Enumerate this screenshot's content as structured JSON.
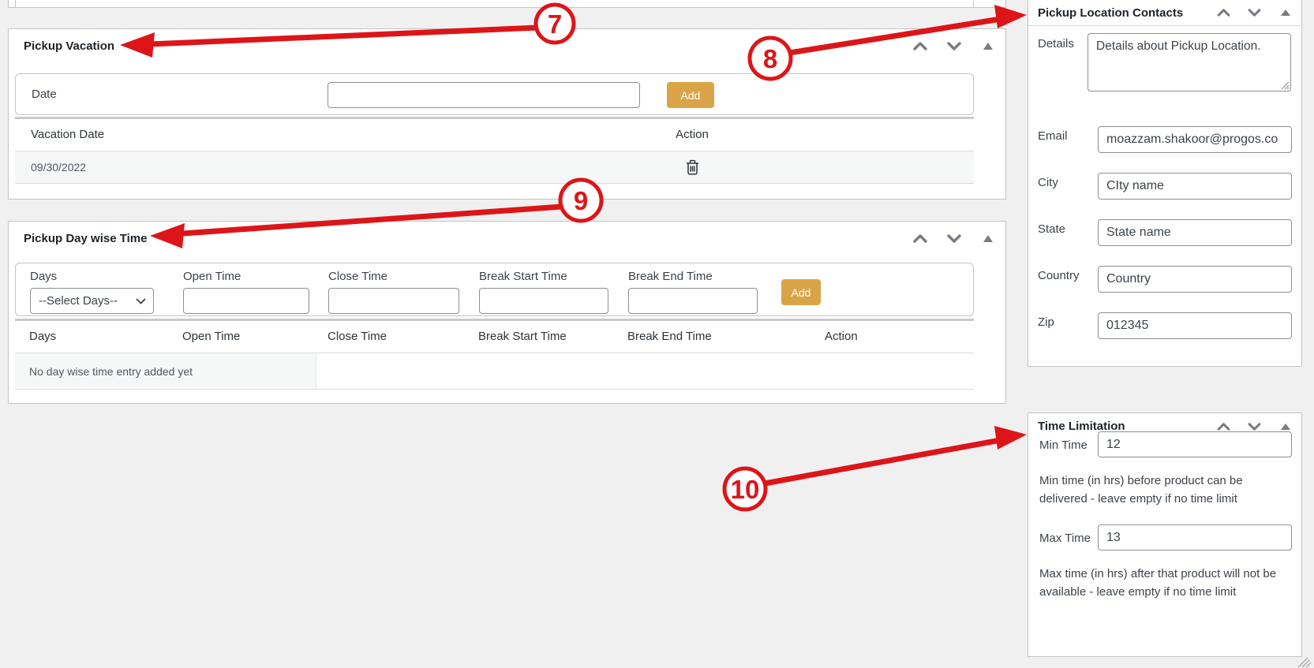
{
  "colors": {
    "page_bg": "#f0f0f1",
    "panel_border": "#c3c4c7",
    "input_border": "#8c8f94",
    "separator": "#dcdcde",
    "stripe_bg": "#f6f7f7",
    "title_text": "#1d2327",
    "body_text": "#3c434a",
    "muted_text": "#50575e",
    "icon_gray": "#787c82",
    "button_gold": "#d9a448",
    "accent_red": "#dd1518"
  },
  "icons": {
    "collapse_up": "chevron-up",
    "collapse_down": "chevron-down",
    "panel_toggle": "triangle-up",
    "delete": "trash",
    "select_arrow": "chevron-down"
  },
  "main": {
    "pickup_vacation": {
      "title": "Pickup Vacation",
      "form": {
        "date_label": "Date",
        "date_value": "",
        "add_label": "Add"
      },
      "table": {
        "col_date": "Vacation Date",
        "col_action": "Action",
        "row_date": "09/30/2022"
      }
    },
    "pickup_day_wise_time": {
      "title": "Pickup Day wise Time",
      "form": {
        "days_label": "Days",
        "days_value": "--Select Days--",
        "open_label": "Open Time",
        "close_label": "Close Time",
        "break_start_label": "Break Start Time",
        "break_end_label": "Break End Time",
        "add_label": "Add"
      },
      "table": {
        "col_days": "Days",
        "col_open": "Open Time",
        "col_close": "Close Time",
        "col_break_start": "Break Start Time",
        "col_break_end": "Break End Time",
        "col_action": "Action",
        "empty_text": "No day wise time entry added yet"
      }
    }
  },
  "sidebar": {
    "pickup_location_contacts": {
      "title": "Pickup Location Contacts",
      "details_label": "Details",
      "details_value": "Details about Pickup Location.",
      "email_label": "Email",
      "email_value": "moazzam.shakoor@progos.co",
      "city_label": "City",
      "city_value": "CIty name",
      "state_label": "State",
      "state_value": "State name",
      "country_label": "Country",
      "country_value": "Country",
      "zip_label": "Zip",
      "zip_value": "012345"
    },
    "time_limitation": {
      "title": "Time Limitation",
      "min_label": "Min Time",
      "min_value": "12",
      "min_help": "Min time (in hrs) before product can be delivered - leave empty if no time limit",
      "max_label": "Max Time",
      "max_value": "13",
      "max_help": "Max time (in hrs) after that product will not be available - leave empty if no time limit"
    }
  },
  "annotations": [
    {
      "number": "7",
      "target": "Pickup Vacation"
    },
    {
      "number": "8",
      "target": "Pickup Location Contacts"
    },
    {
      "number": "9",
      "target": "Pickup Day wise Time"
    },
    {
      "number": "10",
      "target": "Time Limitation"
    }
  ]
}
